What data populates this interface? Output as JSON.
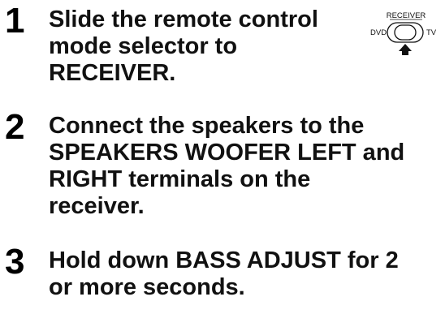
{
  "steps": [
    {
      "number": "1",
      "lines": [
        "Slide the remote control",
        "mode selector to",
        "RECEIVER."
      ]
    },
    {
      "number": "2",
      "lines": [
        "Connect the speakers to the",
        "SPEAKERS WOOFER LEFT and",
        "RIGHT terminals on the",
        "receiver."
      ]
    },
    {
      "number": "3",
      "lines": [
        "Hold down BASS ADJUST for 2",
        "or more seconds."
      ]
    }
  ],
  "mode_selector": {
    "top_label": "RECEIVER",
    "left_label": "DVD",
    "right_label": "TV",
    "selected_position": "RECEIVER",
    "icons": [
      "mode-selector-switch-icon",
      "up-arrow-icon"
    ]
  }
}
